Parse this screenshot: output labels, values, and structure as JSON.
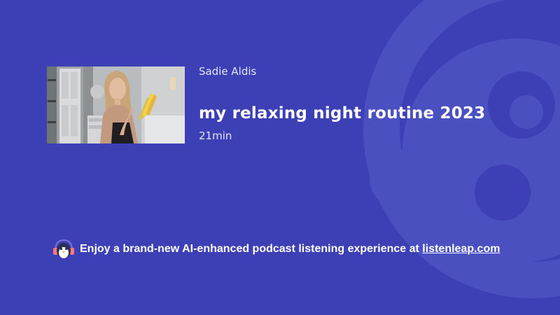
{
  "episode": {
    "author": "Sadie Aldis",
    "title": "my relaxing night routine 2023",
    "duration": "21min"
  },
  "promo": {
    "text": "Enjoy a brand-new AI-enhanced podcast listening experience at ",
    "link_text": "listenleap.com"
  },
  "icons": {
    "mascot": "penguin-headphones-icon",
    "watermark": "listenleap-logo-watermark"
  },
  "colors": {
    "background": "#3d40b5",
    "watermark": "#4a50c0",
    "text": "#ffffff",
    "muted_text": "#e4e5f7"
  }
}
